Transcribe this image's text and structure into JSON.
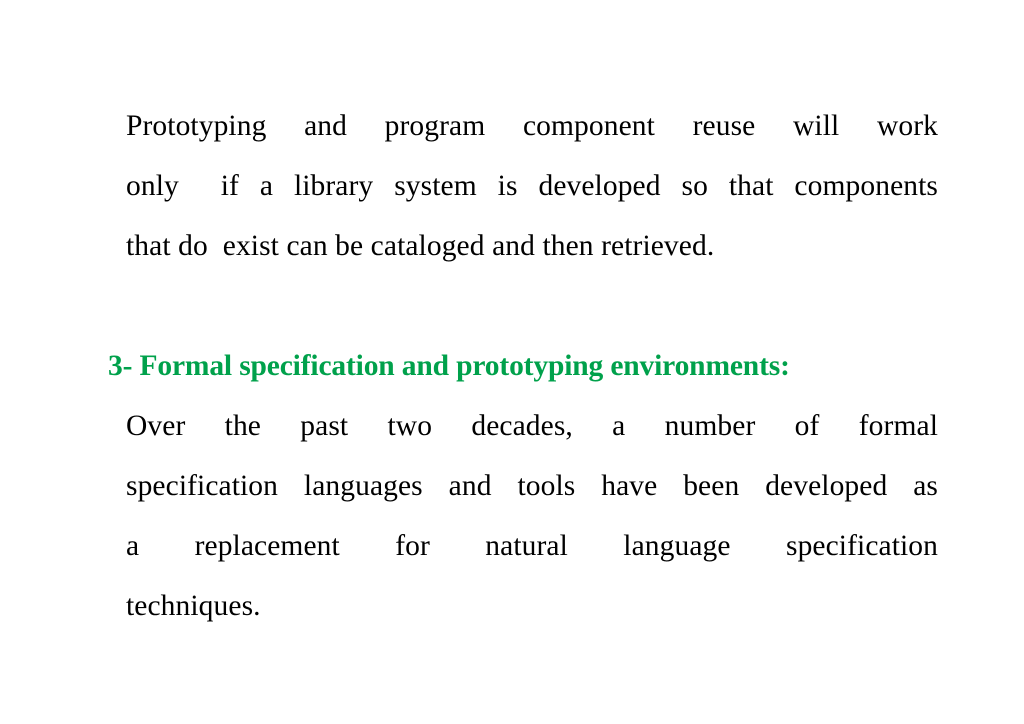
{
  "slide": {
    "background_color": "#FFFFFF",
    "body_text_color": "#000000",
    "heading_color": "#00A14B",
    "paragraph_1": {
      "full_text": "Prototyping and program component reuse will work only  if a library system is developed so that components that do  exist can be cataloged and then retrieved.",
      "lines": [
        "Prototyping and program component reuse will work",
        "only  if a library system is developed so that components",
        "that do  exist can be cataloged and then retrieved."
      ]
    },
    "heading": {
      "number": "3-",
      "text": "3- Formal specification and prototyping environments:"
    },
    "paragraph_2": {
      "full_text": "Over the past two decades, a number of formal specification languages and tools have been developed as a replacement for natural language specification techniques.",
      "lines": [
        "Over the past two decades, a number of formal",
        "specification languages and tools have been developed as",
        "a replacement for natural language specification",
        "techniques."
      ]
    }
  }
}
